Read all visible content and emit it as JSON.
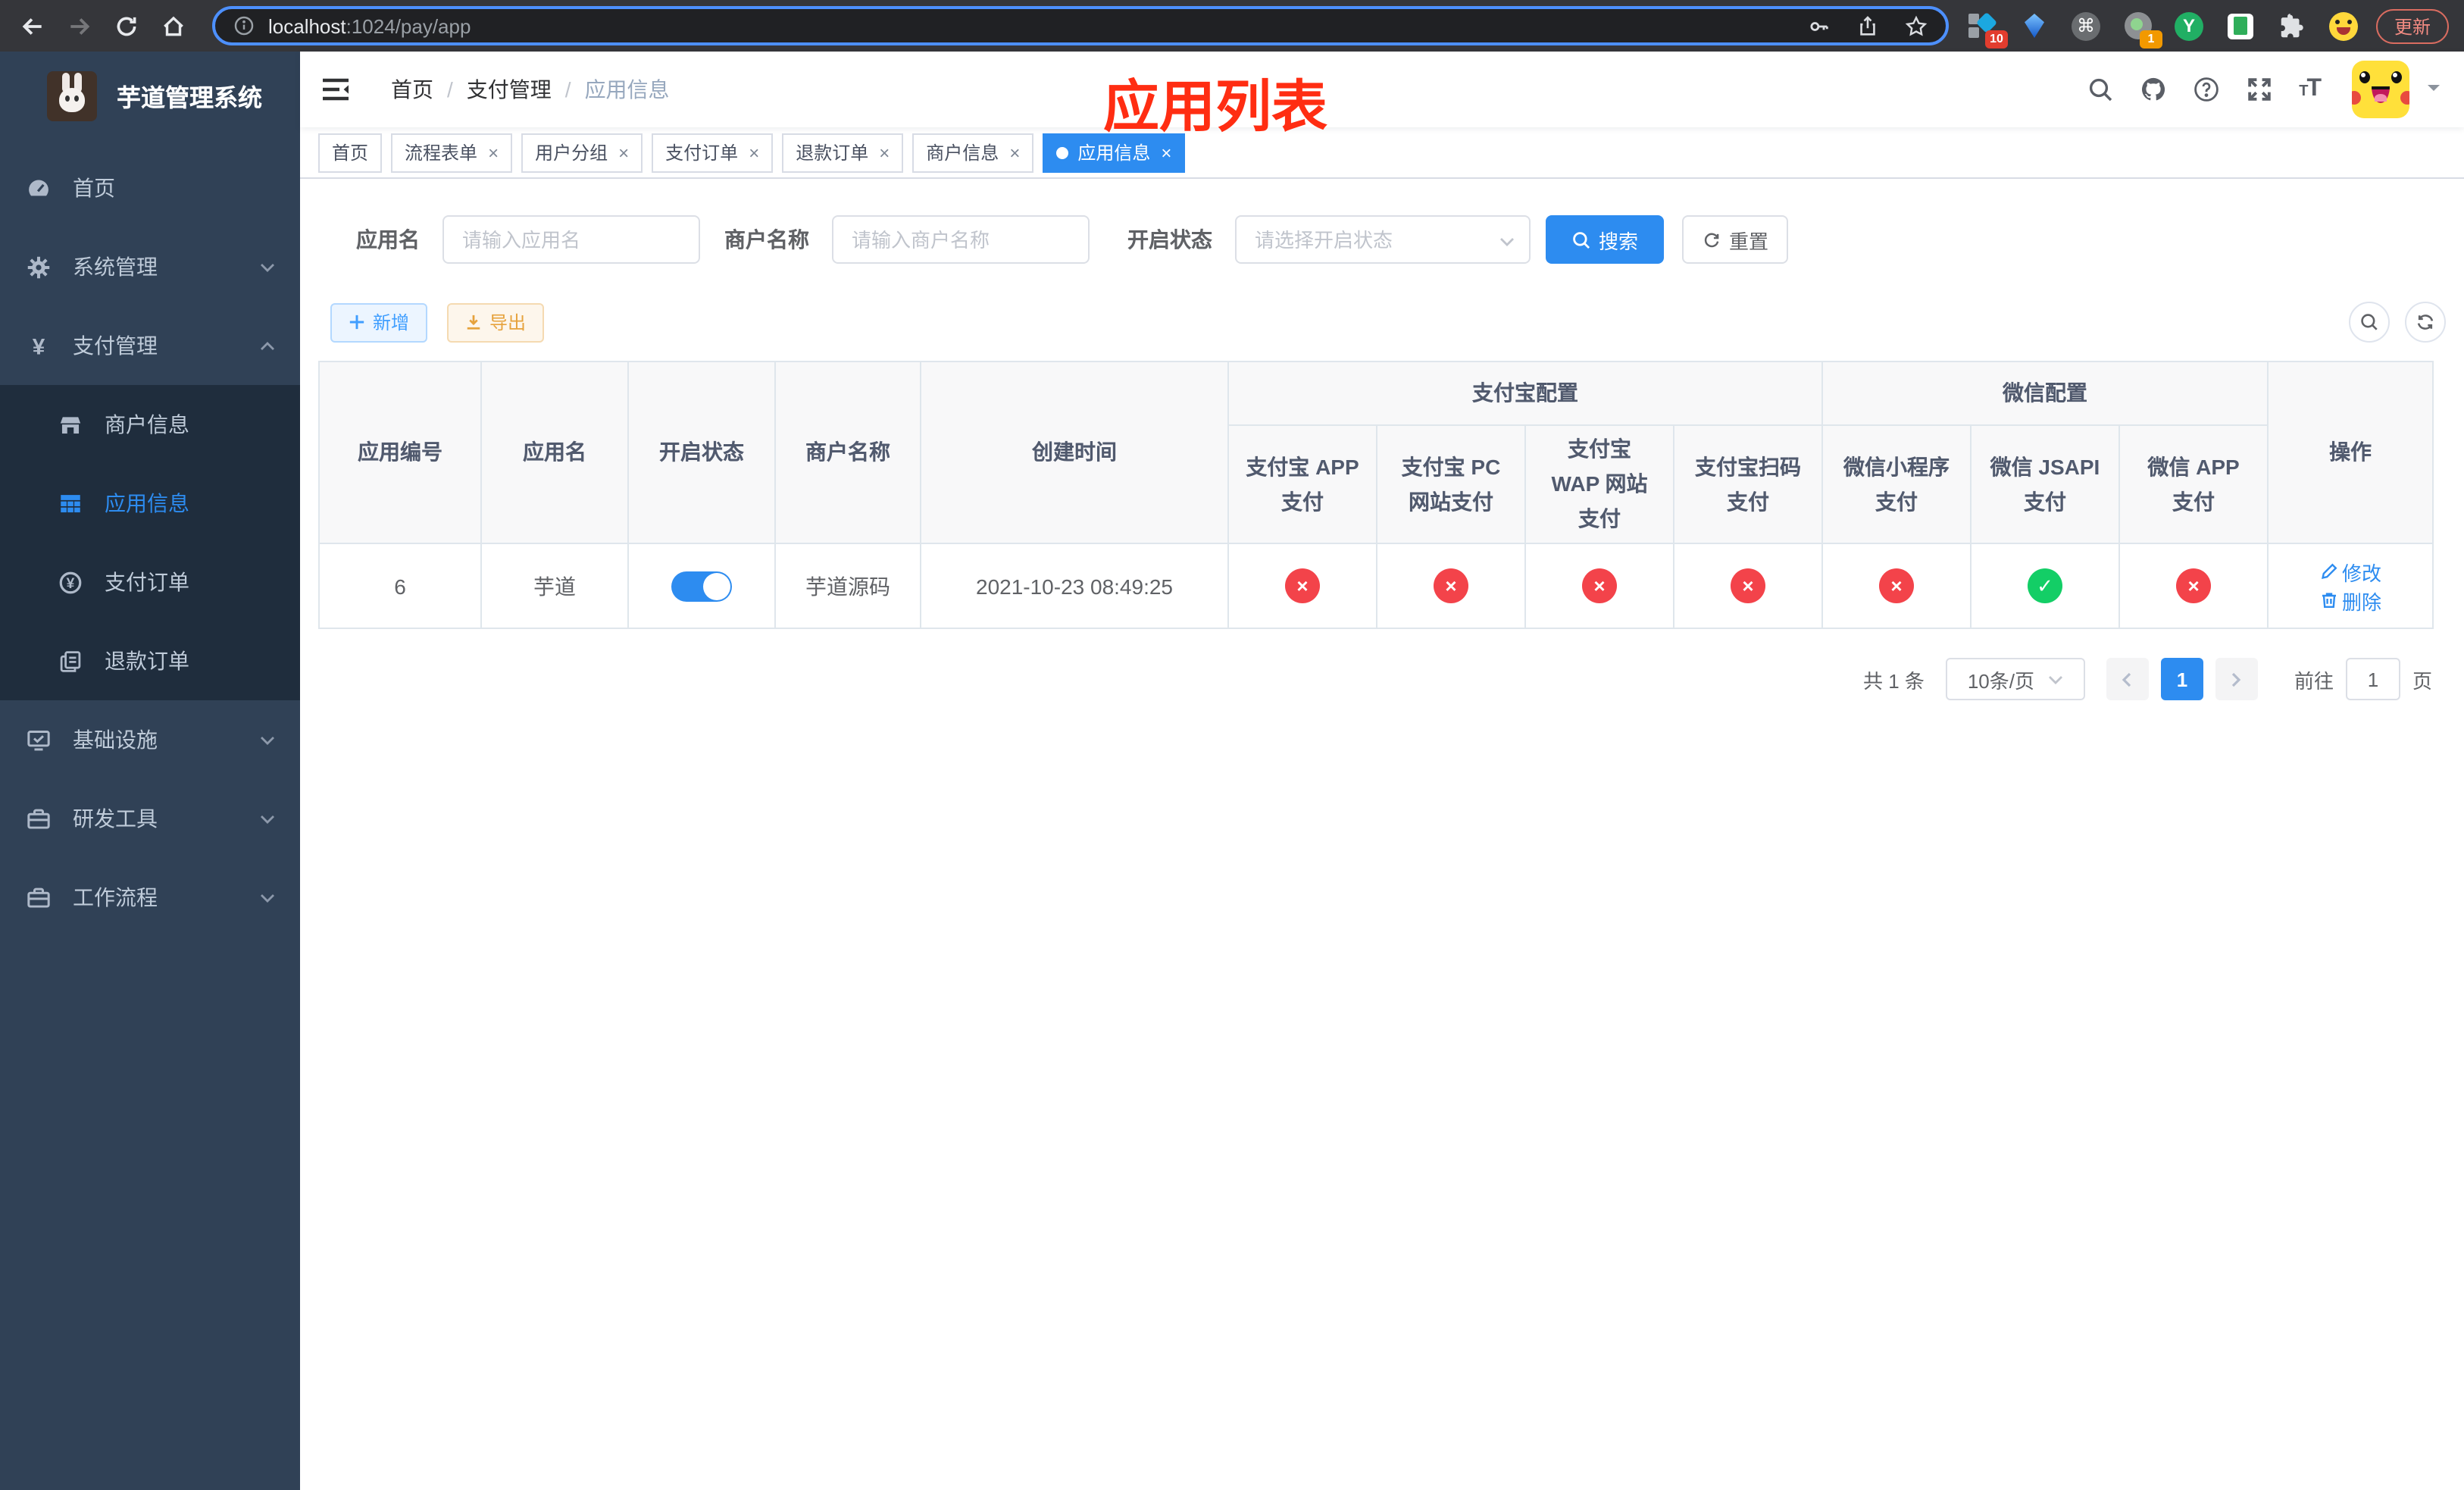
{
  "colors": {
    "accent": "#2d8cf0",
    "danger": "#f3434a",
    "success": "#13ce66",
    "annotation": "#ff2d12",
    "sidebar_bg": "#304156",
    "submenu_bg": "#1f2d3d"
  },
  "browser": {
    "url_host": "localhost",
    "url_path": ":1024/pay/app",
    "update_label": "更新",
    "ext_badge_pin": "10",
    "ext_badge_session": "1"
  },
  "sidebar": {
    "logo_title": "芋道管理系统",
    "menu": [
      {
        "label": "首页",
        "icon": "dashboard-icon",
        "name": "home"
      },
      {
        "label": "系统管理",
        "icon": "gear-icon",
        "expand": "down",
        "name": "system"
      },
      {
        "label": "支付管理",
        "icon": "yen-icon",
        "expand": "up",
        "name": "payment",
        "children": [
          {
            "label": "商户信息",
            "icon": "shop-icon",
            "name": "merchant-info"
          },
          {
            "label": "应用信息",
            "icon": "grid-icon",
            "active": true,
            "name": "app-info"
          },
          {
            "label": "支付订单",
            "icon": "pay-order-icon",
            "name": "pay-orders"
          },
          {
            "label": "退款订单",
            "icon": "refund-order-icon",
            "name": "refund-orders"
          }
        ]
      },
      {
        "label": "基础设施",
        "icon": "monitor-icon",
        "expand": "down",
        "name": "infrastructure"
      },
      {
        "label": "研发工具",
        "icon": "toolbox-icon",
        "expand": "down",
        "name": "dev-tools"
      },
      {
        "label": "工作流程",
        "icon": "toolbox-icon",
        "expand": "down",
        "name": "workflow"
      }
    ]
  },
  "breadcrumb": {
    "items": [
      "首页",
      "支付管理",
      "应用信息"
    ]
  },
  "annotation": {
    "text": "应用列表"
  },
  "tabs": [
    {
      "label": "首页",
      "closable": false,
      "active": false
    },
    {
      "label": "流程表单",
      "closable": true,
      "active": false
    },
    {
      "label": "用户分组",
      "closable": true,
      "active": false
    },
    {
      "label": "支付订单",
      "closable": true,
      "active": false
    },
    {
      "label": "退款订单",
      "closable": true,
      "active": false
    },
    {
      "label": "商户信息",
      "closable": true,
      "active": false
    },
    {
      "label": "应用信息",
      "closable": true,
      "active": true
    }
  ],
  "filters": {
    "app_name_label": "应用名",
    "app_name_placeholder": "请输入应用名",
    "merchant_label": "商户名称",
    "merchant_placeholder": "请输入商户名称",
    "status_label": "开启状态",
    "status_placeholder": "请选择开启状态",
    "search_label": "搜索",
    "reset_label": "重置"
  },
  "toolbar": {
    "add_label": "新增",
    "export_label": "导出"
  },
  "table": {
    "header": {
      "simple": [
        "应用编号",
        "应用名",
        "开启状态",
        "商户名称",
        "创建时间"
      ],
      "groups": [
        {
          "label": "支付宝配置",
          "children": [
            "支付宝 APP 支付",
            "支付宝 PC 网站支付",
            "支付宝 WAP 网站支付",
            "支付宝扫码支付"
          ]
        },
        {
          "label": "微信配置",
          "children": [
            "微信小程序支付",
            "微信 JSAPI 支付",
            "微信 APP 支付"
          ]
        }
      ],
      "action": "操作"
    },
    "rows": [
      {
        "id": "6",
        "name": "芋道",
        "enabled": true,
        "merchant": "芋道源码",
        "created": "2021-10-23 08:49:25",
        "statuses": [
          false,
          false,
          false,
          false,
          false,
          true,
          false
        ],
        "edit_label": "修改",
        "delete_label": "删除"
      }
    ]
  },
  "pagination": {
    "total": "共 1 条",
    "page_size": "10条/页",
    "page": "1",
    "goto_prefix": "前往",
    "goto_value": "1",
    "goto_suffix": "页"
  }
}
